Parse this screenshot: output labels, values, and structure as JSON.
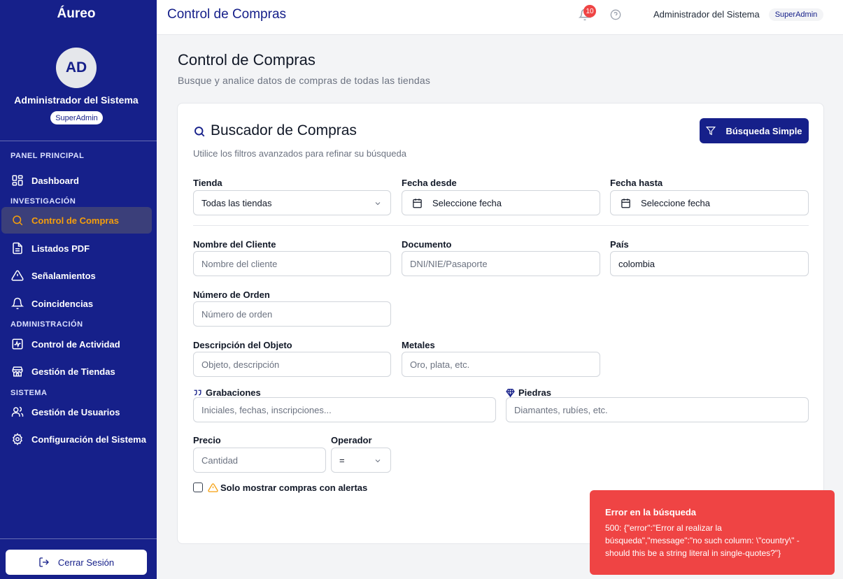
{
  "sidebar": {
    "brand": "Áureo",
    "avatar_initials": "AD",
    "user_name": "Administrador del Sistema",
    "user_role": "SuperAdmin",
    "sections": {
      "panel": "PANEL PRINCIPAL",
      "investigacion": "INVESTIGACIÓN",
      "administracion": "ADMINISTRACIÓN",
      "sistema": "SISTEMA"
    },
    "items": {
      "dashboard": "Dashboard",
      "control_compras": "Control de Compras",
      "listados_pdf": "Listados PDF",
      "senalamientos": "Señalamientos",
      "coincidencias": "Coincidencias",
      "control_actividad": "Control de Actividad",
      "gestion_tiendas": "Gestión de Tiendas",
      "gestion_usuarios": "Gestión de Usuarios",
      "configuracion": "Configuración del Sistema"
    },
    "logout": "Cerrar Sesión"
  },
  "topbar": {
    "title": "Control de Compras",
    "notifications_count": "10",
    "user_name": "Administrador del Sistema",
    "user_role": "SuperAdmin"
  },
  "page": {
    "title": "Control de Compras",
    "subtitle": "Busque y analice datos de compras de todas las tiendas"
  },
  "search": {
    "title": "Buscador de Compras",
    "subtitle": "Utilice los filtros avanzados para refinar su búsqueda",
    "simple_button": "Búsqueda Simple",
    "fields": {
      "tienda": {
        "label": "Tienda",
        "value": "Todas las tiendas"
      },
      "fecha_desde": {
        "label": "Fecha desde",
        "value": "Seleccione fecha"
      },
      "fecha_hasta": {
        "label": "Fecha hasta",
        "value": "Seleccione fecha"
      },
      "nombre_cliente": {
        "label": "Nombre del Cliente",
        "placeholder": "Nombre del cliente"
      },
      "documento": {
        "label": "Documento",
        "placeholder": "DNI/NIE/Pasaporte"
      },
      "pais": {
        "label": "País",
        "value": "colombia"
      },
      "numero_orden": {
        "label": "Número de Orden",
        "placeholder": "Número de orden"
      },
      "descripcion": {
        "label": "Descripción del Objeto",
        "placeholder": "Objeto, descripción"
      },
      "metales": {
        "label": "Metales",
        "placeholder": "Oro, plata, etc."
      },
      "grabaciones": {
        "label": "Grabaciones",
        "placeholder": "Iniciales, fechas, inscripciones..."
      },
      "piedras": {
        "label": "Piedras",
        "placeholder": "Diamantes, rubíes, etc."
      },
      "precio": {
        "label": "Precio",
        "placeholder": "Cantidad"
      },
      "operador": {
        "label": "Operador",
        "value": "="
      }
    },
    "alerts_checkbox": "Solo mostrar compras con alertas"
  },
  "toast": {
    "title": "Error en la búsqueda",
    "message": "500: {\"error\":\"Error al realizar la búsqueda\",\"message\":\"no such column: \\\"country\\\" - should this be a string literal in single-quotes?\"}"
  },
  "colors": {
    "sidebar_bg": "#16208a",
    "accent_active": "#f59e0b",
    "error": "#ef4444"
  }
}
